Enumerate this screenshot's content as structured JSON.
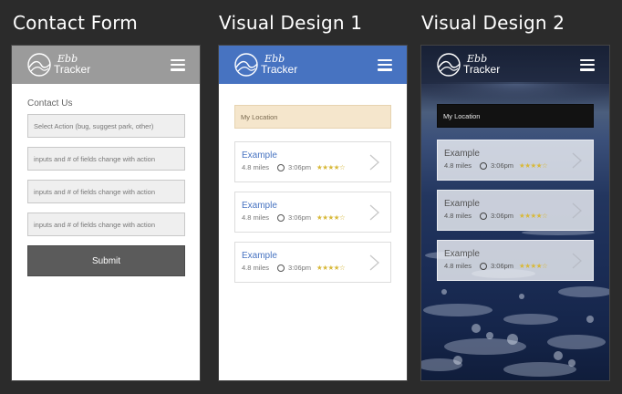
{
  "headings": [
    "Contact Form",
    "Visual Design 1",
    "Visual Design 2"
  ],
  "logo": {
    "line1": "Ebb",
    "line2": "Tracker"
  },
  "contact_form": {
    "title": "Contact Us",
    "fields": [
      "Select Action (bug, suggest park, other)",
      "inputs and # of fields change with action",
      "inputs and # of fields change with action",
      "inputs and # of fields change with action"
    ],
    "submit_label": "Submit"
  },
  "visual1": {
    "location_placeholder": "My Location",
    "cards": [
      {
        "title": "Example",
        "distance": "4.8 miles",
        "time": "3:06pm",
        "stars": "★★★★☆"
      },
      {
        "title": "Example",
        "distance": "4.8 miles",
        "time": "3:06pm",
        "stars": "★★★★☆"
      },
      {
        "title": "Example",
        "distance": "4.8 miles",
        "time": "3:06pm",
        "stars": "★★★★☆"
      }
    ]
  },
  "visual2": {
    "location_placeholder": "My Location",
    "cards": [
      {
        "title": "Example",
        "distance": "4.8 miles",
        "time": "3:06pm",
        "stars": "★★★★☆"
      },
      {
        "title": "Example",
        "distance": "4.8 miles",
        "time": "3:06pm",
        "stars": "★★★★☆"
      },
      {
        "title": "Example",
        "distance": "4.8 miles",
        "time": "3:06pm",
        "stars": "★★★★☆"
      }
    ]
  },
  "colors": {
    "background": "#2b2b2b",
    "contact_header": "#9b9b9b",
    "visual1_header": "#4773c1",
    "visual1_location_bg": "#f5e6cc",
    "star": "#d8b93a",
    "submit_bg": "#5b5b5b"
  },
  "icons": [
    "logo-wave-icon",
    "hamburger-menu-icon",
    "clock-icon",
    "star-rating",
    "chevron-right-icon"
  ]
}
